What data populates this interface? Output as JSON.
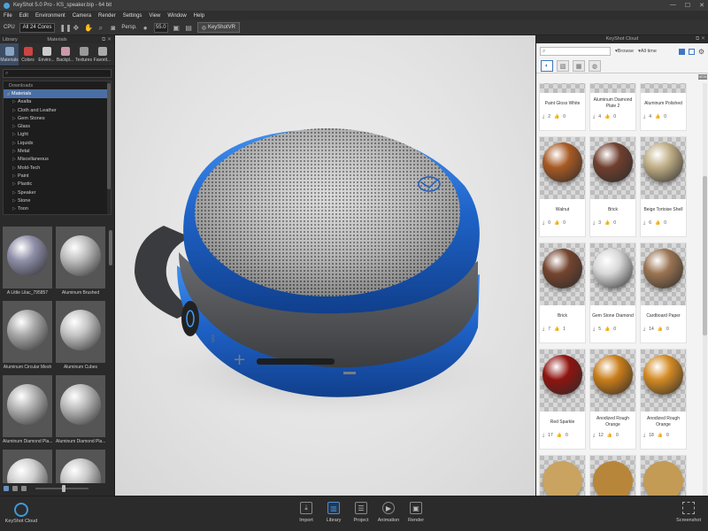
{
  "window": {
    "title": "KeyShot 5.0 Pro  -  KS_speaker.bip  -  64 bit",
    "controls": [
      "—",
      "☐",
      "✕"
    ]
  },
  "menu": [
    "File",
    "Edit",
    "Environment",
    "Camera",
    "Render",
    "Settings",
    "View",
    "Window",
    "Help"
  ],
  "toolbar": {
    "cpu_label": "CPU",
    "cpu_value": "All 24 Cores",
    "camera_value": "Persp.",
    "focal_value": "55.0",
    "keyshot_button": "KeyShotVR"
  },
  "library": {
    "header": "Library",
    "sub_header": "Materials",
    "tabs": [
      "Materials",
      "Colors",
      "Enviro...",
      "Backpl...",
      "Textures",
      "Favorit..."
    ],
    "search_placeholder": "",
    "tree_root": "Downloads",
    "tree_selected": "Materials",
    "tree_items": [
      "Axalta",
      "Cloth and Leather",
      "Gem Stones",
      "Glass",
      "Light",
      "Liquids",
      "Metal",
      "Miscellaneous",
      "Mold-Tech",
      "Paint",
      "Plastic",
      "Speaker",
      "Stone",
      "Toon"
    ],
    "thumbnails": [
      {
        "label": "A Little Lilac_795857",
        "color": "#8e8ea8"
      },
      {
        "label": "Aluminum Brushed",
        "color": "#bdbdbd"
      },
      {
        "label": "Aluminum Circular Mesh",
        "color": "#a9a9a9"
      },
      {
        "label": "Aluminum Cubes",
        "color": "#c4c4c4"
      },
      {
        "label": "Aluminum Diamond Pla...",
        "color": "#b3b3b3"
      },
      {
        "label": "Aluminum Diamond Pla...",
        "color": "#bababa"
      },
      {
        "label": "",
        "color": "#cfcfcf"
      },
      {
        "label": "",
        "color": "#c8c8c8"
      }
    ]
  },
  "cloud_panel": {
    "header": "KeyShot Cloud",
    "search_placeholder": "",
    "browse_label": "Browse",
    "time_label": "All time",
    "badge": "NEW",
    "cards": [
      {
        "name": "Paint Gloss White",
        "downloads": "2",
        "likes": "0",
        "color": "#e6e6e6"
      },
      {
        "name": "Aluminum Diamond Plate 2",
        "downloads": "4",
        "likes": "0",
        "color": "#b4b4b4"
      },
      {
        "name": "Aluminum Polished",
        "downloads": "4",
        "likes": "0",
        "color": "#cfcfcf"
      },
      {
        "name": "Walnut",
        "downloads": "0",
        "likes": "0",
        "color": "#a85a24"
      },
      {
        "name": "Brick",
        "downloads": "3",
        "likes": "0",
        "color": "#6f3f2e"
      },
      {
        "name": "Beige Tortoise Shell",
        "downloads": "6",
        "likes": "0",
        "color": "#bfae86"
      },
      {
        "name": "Brick",
        "downloads": "7",
        "likes": "1",
        "color": "#74452f"
      },
      {
        "name": "Gem Stone Diamond",
        "downloads": "5",
        "likes": "0",
        "color": "#d8d8d8"
      },
      {
        "name": "Cardboard Paper",
        "downloads": "14",
        "likes": "0",
        "color": "#9a7452"
      },
      {
        "name": "Red Sparkle",
        "downloads": "17",
        "likes": "0",
        "color": "#8f1410"
      },
      {
        "name": "Anodized Rough Orange",
        "downloads": "12",
        "likes": "0",
        "color": "#c97d1a"
      },
      {
        "name": "Anodized Rough Orange",
        "downloads": "18",
        "likes": "0",
        "color": "#d38a24"
      }
    ]
  },
  "bottom": {
    "cloud_label": "KeyShot Cloud",
    "nav": [
      "Import",
      "Library",
      "Project",
      "Animation",
      "Render"
    ],
    "screenshot_label": "Screenshot"
  },
  "colors": {
    "accent": "#4a8fd6",
    "speaker_blue": "#1f63c8"
  }
}
